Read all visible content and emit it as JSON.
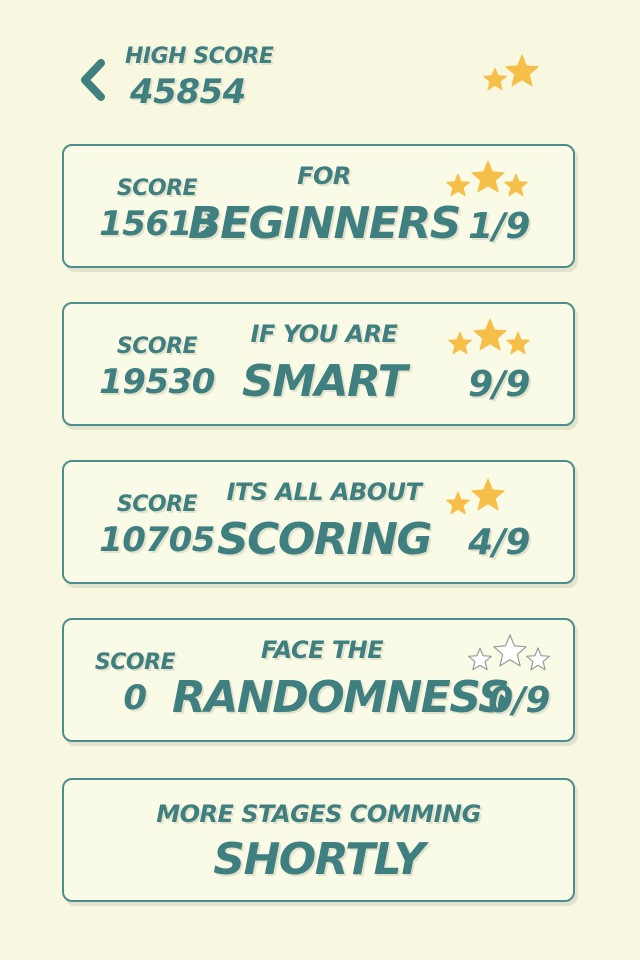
{
  "header": {
    "high_score_label": "HIGH SCORE",
    "high_score_value": "45854",
    "back_icon": "chevron-left-icon",
    "stars_earned_shown": 2
  },
  "stages": [
    {
      "score_label": "SCORE",
      "score": "15619",
      "subtitle": "FOR",
      "title": "BEGINNERS",
      "progress": "1/9",
      "stars_filled": 3,
      "stars_total": 3
    },
    {
      "score_label": "SCORE",
      "score": "19530",
      "subtitle": "IF YOU ARE",
      "title": "SMART",
      "progress": "9/9",
      "stars_filled": 3,
      "stars_total": 3
    },
    {
      "score_label": "SCORE",
      "score": "10705",
      "subtitle": "ITS ALL ABOUT",
      "title": "SCORING",
      "progress": "4/9",
      "stars_filled": 2,
      "stars_total": 2
    },
    {
      "score_label": "SCORE",
      "score": "0",
      "subtitle": "FACE THE",
      "title": "RANDOMNESS",
      "progress": "0/9",
      "stars_filled": 0,
      "stars_total": 3
    }
  ],
  "coming_soon": {
    "subtitle": "MORE STAGES COMMING",
    "title": "SHORTLY"
  },
  "colors": {
    "background": "#f8f8e0",
    "text": "#3f7f80",
    "card_border": "#4b8e8b",
    "star_gold": "#f6bf4a",
    "star_outline": "#9a9a9a"
  }
}
